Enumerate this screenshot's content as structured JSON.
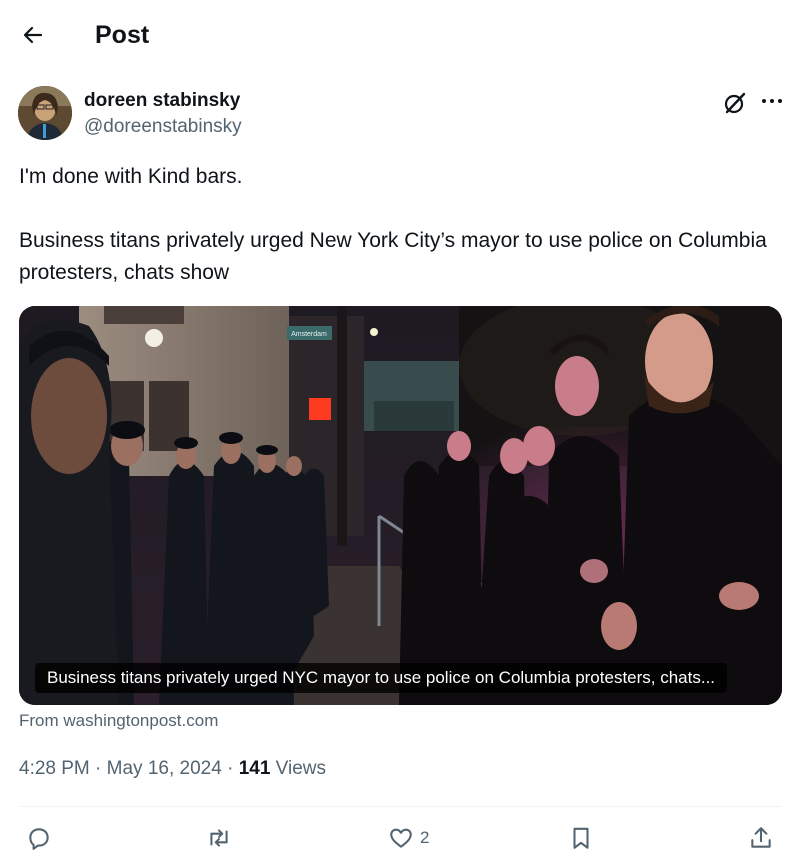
{
  "header": {
    "title": "Post"
  },
  "author": {
    "name": "doreen stabinsky",
    "handle": "@doreenstabinsky"
  },
  "post": {
    "line1": "I'm done with Kind bars.",
    "line2": "Business titans privately urged New York City’s mayor to use police on Columbia protesters, chats show"
  },
  "link_card": {
    "caption": "Business titans privately urged NYC mayor to use police on Columbia protesters, chats...",
    "source": "From washingtonpost.com",
    "street_sign": "Amsterdam"
  },
  "meta": {
    "time": "4:28 PM",
    "separator": " · ",
    "date": "May 16, 2024",
    "views_count": "141",
    "views_label": " Views"
  },
  "actions": {
    "reply_icon": "reply-icon",
    "repost_icon": "repost-icon",
    "like_icon": "heart-icon",
    "like_count": "2",
    "bookmark_icon": "bookmark-icon",
    "share_icon": "share-icon"
  }
}
